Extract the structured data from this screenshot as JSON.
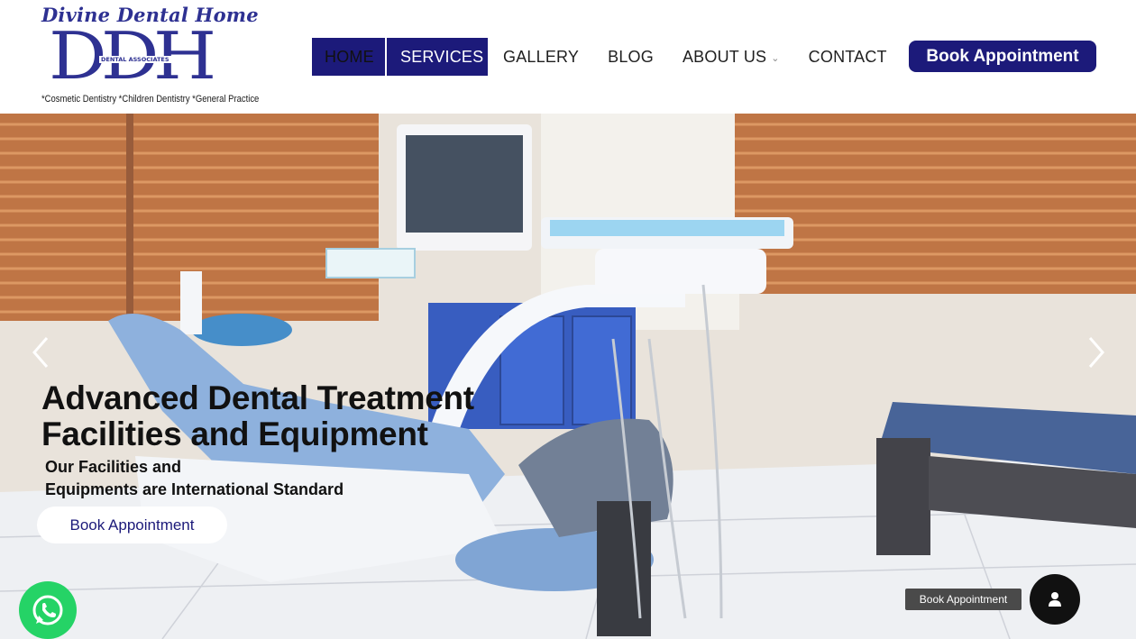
{
  "logo": {
    "script_text": "Divine Dental Home",
    "monogram": "DDH",
    "associates": "DENTAL ASSOCIATES",
    "tagline": "*Cosmetic Dentistry  *Children Dentistry  *General Practice"
  },
  "nav": {
    "items": [
      {
        "label": "HOME"
      },
      {
        "label": "SERVICES"
      },
      {
        "label": "GALLERY"
      },
      {
        "label": "BLOG"
      },
      {
        "label": "ABOUT US"
      },
      {
        "label": "CONTACT"
      }
    ]
  },
  "header": {
    "book_label": "Book Appointment"
  },
  "hero": {
    "title_line1": "Advanced Dental Treatment",
    "title_line2": "Facilities and Equipment",
    "subtitle_line1": "Our Facilities and",
    "subtitle_line2": "Equipments are International Standard",
    "cta_label": "Book Appointment",
    "prev_icon": "chevron-left",
    "next_icon": "chevron-right"
  },
  "floating": {
    "label": "Book Appointment",
    "icon": "user-icon",
    "whatsapp_icon": "whatsapp-icon"
  },
  "colors": {
    "brand": "#1c1a7a",
    "logo": "#2e3192",
    "whatsapp": "#25d366"
  }
}
